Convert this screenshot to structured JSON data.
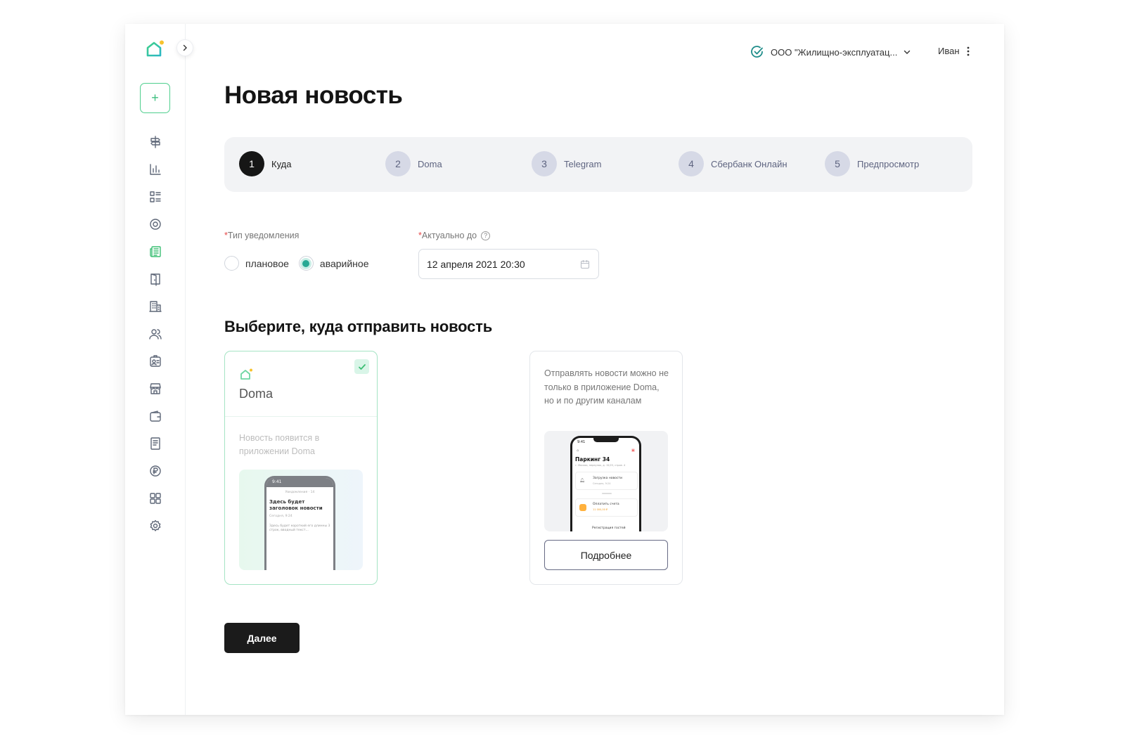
{
  "org": {
    "name": "ООО \"Жилищно-эксплуатац..."
  },
  "user": {
    "name": "Иван"
  },
  "page": {
    "title": "Новая новость"
  },
  "sidebar": {
    "items": [
      {
        "icon": "signpost-icon",
        "active": false
      },
      {
        "icon": "bar-chart-icon",
        "active": false
      },
      {
        "icon": "list-grid-icon",
        "active": false
      },
      {
        "icon": "at-sign-icon",
        "active": false
      },
      {
        "icon": "newspaper-icon",
        "active": true
      },
      {
        "icon": "door-icon",
        "active": false
      },
      {
        "icon": "building-icon",
        "active": false
      },
      {
        "icon": "users-icon",
        "active": false
      },
      {
        "icon": "contact-card-icon",
        "active": false
      },
      {
        "icon": "store-icon",
        "active": false
      },
      {
        "icon": "wallet-icon",
        "active": false
      },
      {
        "icon": "document-icon",
        "active": false
      },
      {
        "icon": "currency-icon",
        "active": false
      },
      {
        "icon": "apps-icon",
        "active": false
      },
      {
        "icon": "settings-icon",
        "active": false
      }
    ]
  },
  "steps": [
    {
      "num": "1",
      "label": "Куда",
      "active": true
    },
    {
      "num": "2",
      "label": "Doma",
      "active": false
    },
    {
      "num": "3",
      "label": "Telegram",
      "active": false
    },
    {
      "num": "4",
      "label": "Сбербанк Онлайн",
      "active": false
    },
    {
      "num": "5",
      "label": "Предпросмотр",
      "active": false
    }
  ],
  "form": {
    "notification_type_label": "Тип уведомления",
    "required_mark": "*",
    "options": [
      {
        "label": "плановое",
        "checked": false
      },
      {
        "label": "аварийное",
        "checked": true
      }
    ],
    "actual_until_label": "Актуально до",
    "help_glyph": "?",
    "date_value": "12 апреля 2021 20:30"
  },
  "section": {
    "title": "Выберите, куда отправить новость"
  },
  "cards": {
    "doma": {
      "name": "Doma",
      "selected": true,
      "description": "Новость появится в приложении Doma",
      "preview": {
        "time": "9:41",
        "top_text": "Уведомления · 14",
        "headline": "Здесь будет заголовок новости",
        "date": "Сегодня, 9:24",
        "body": "Здесь будет короткий его длинны 3 строк, вводный текст..."
      }
    },
    "other": {
      "description": "Отправлять новости можно не только в приложение Doma, но и по другим каналам",
      "button": "Подробнее",
      "preview": {
        "time": "9:41",
        "title": "Паркинг 34",
        "address": "г. Москва, переулок, д. 15/23, строе. 4",
        "item1": "Загрузка новости",
        "item1_sub": "Сегодня, 9:24",
        "item2": "Оплатить счета",
        "item2_sub": "11 000,00 ₽",
        "item3": "Регистрация гостей"
      }
    }
  },
  "actions": {
    "next": "Далее"
  },
  "colors": {
    "accent": "#3cbf74",
    "radio": "#27a894",
    "dark": "#1b1b1b"
  }
}
